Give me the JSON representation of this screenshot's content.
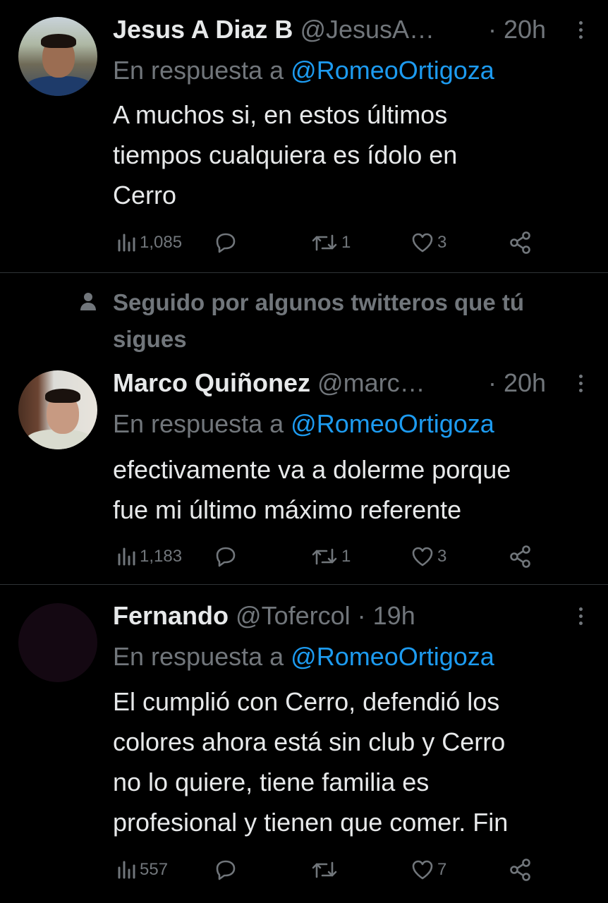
{
  "colors": {
    "background": "#000000",
    "text": "#e7e9ea",
    "muted": "#71767b",
    "link": "#1d9bf0",
    "divider": "#2f3336"
  },
  "icons": [
    "views-icon",
    "reply-icon",
    "retweet-icon",
    "like-icon",
    "share-icon",
    "more-icon",
    "person-icon"
  ],
  "tweets": [
    {
      "name": "Jesus A Diaz B",
      "handle": "@JesusA…",
      "time": "· 20h",
      "reply_prefix": "En respuesta a ",
      "reply_to": "@RomeoOrtigoza",
      "text_lines": [
        "A muchos si, en estos últimos",
        "tiempos cualquiera es ídolo en",
        "Cerro"
      ],
      "views": "1,085",
      "replies": "",
      "retweets": "1",
      "likes": "3"
    },
    {
      "social_context": [
        "Seguido por algunos twitteros que tú",
        "sigues"
      ],
      "name": "Marco Quiñonez",
      "handle": "@marc…",
      "time": "· 20h",
      "reply_prefix": "En respuesta a ",
      "reply_to": "@RomeoOrtigoza",
      "text_lines": [
        "efectivamente va a dolerme porque",
        "fue mi último máximo referente"
      ],
      "views": "1,183",
      "replies": "",
      "retweets": "1",
      "likes": "3"
    },
    {
      "name": "Fernando",
      "handle": "@Tofercol",
      "time": "· 19h",
      "reply_prefix": "En respuesta a ",
      "reply_to": "@RomeoOrtigoza",
      "text_lines": [
        "El cumplió con Cerro, defendió los",
        "colores ahora está sin club y Cerro",
        "no lo quiere, tiene familia es",
        "profesional y tienen que comer. Fin"
      ],
      "views": "557",
      "replies": "",
      "retweets": "",
      "likes": "7"
    }
  ]
}
